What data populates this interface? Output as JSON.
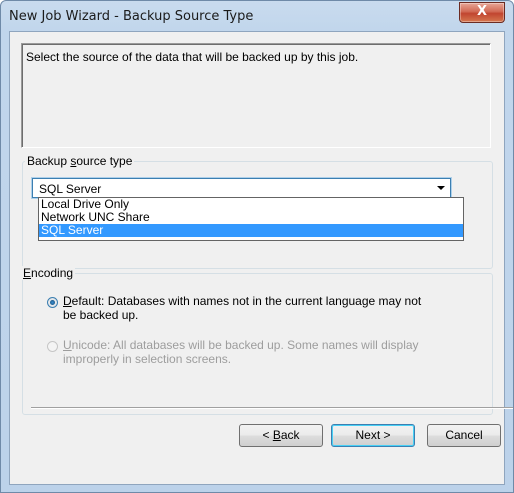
{
  "window": {
    "title": "New Job Wizard - Backup Source Type",
    "close_label": "X"
  },
  "description": "Select the source of the data that will be backed up by this job.",
  "backup_source": {
    "group_label_pre": "Backup ",
    "group_label_mnemonic": "s",
    "group_label_post": "ource type",
    "selected": "SQL Server",
    "options": [
      "Local Drive Only",
      "Network UNC Share",
      "SQL Server"
    ]
  },
  "encoding": {
    "group_label_mnemonic": "E",
    "group_label_post": "ncoding",
    "default_option": {
      "mnemonic": "D",
      "line1_post": "efault: Databases with names not in the current language may not",
      "line2": "be backed up.",
      "checked": true
    },
    "unicode_option": {
      "mnemonic": "U",
      "line1_post": "nicode: All databases will be backed up. Some names will display",
      "line2": "improperly in selection screens.",
      "enabled": false
    }
  },
  "buttons": {
    "back_pre": "< ",
    "back_mnemonic": "B",
    "back_post": "ack",
    "next": "Next >",
    "cancel": "Cancel"
  }
}
